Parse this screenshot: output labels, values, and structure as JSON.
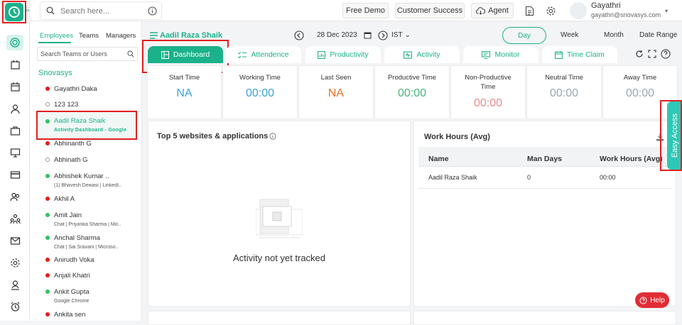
{
  "colors": {
    "accent": "#1bb18a",
    "highlight": "#e02020",
    "na_blue": "#3aa3d8",
    "na_orange": "#e07020",
    "time_green": "#49b77a",
    "time_red": "#e88a8a",
    "time_gray": "#9aa6b2",
    "easy_access": "#2ec8b6",
    "help": "#e12d35"
  },
  "topbar": {
    "search_placeholder": "Search here...",
    "free_demo": "Free Demo",
    "customer_success": "Customer Success",
    "agent": "Agent",
    "user_name": "Gayathri",
    "user_email": "gayathri@snovasys.com"
  },
  "rail": {
    "icons": [
      "target-icon",
      "inbox-icon",
      "calendar-icon",
      "user-icon",
      "briefcase-icon",
      "monitor-icon",
      "card-icon",
      "users-icon",
      "org-icon",
      "mail-icon",
      "settings-icon",
      "person-icon",
      "alarm-icon"
    ]
  },
  "sidebar": {
    "tabs": [
      "Employees",
      "Teams",
      "Managers"
    ],
    "search_placeholder": "Search Teams or Users",
    "org": "Snovasys",
    "employees": [
      {
        "name": "Gayathri Daka",
        "status": "red",
        "sub": ""
      },
      {
        "name": "123 123",
        "status": "off",
        "sub": ""
      },
      {
        "name": "Aadil Raza Shaik",
        "status": "green",
        "sub": "Activity Dashboard - Google"
      },
      {
        "name": "Abhinanth G",
        "status": "red",
        "sub": ""
      },
      {
        "name": "Abhinath G",
        "status": "off",
        "sub": ""
      },
      {
        "name": "Abhishek Kumar ..",
        "status": "green",
        "sub": "(1) Bhavesh Dewasi | LinkedI.."
      },
      {
        "name": "Akhil A",
        "status": "red",
        "sub": ""
      },
      {
        "name": "Amit Jain",
        "status": "green",
        "sub": "Chat | Priyanka Sharma | Mic.."
      },
      {
        "name": "Anchal Sharma",
        "status": "green",
        "sub": "Chat | Sai Sravani | Microso.."
      },
      {
        "name": "Anirudh Voka",
        "status": "red",
        "sub": ""
      },
      {
        "name": "Anjali Khatri",
        "status": "red",
        "sub": ""
      },
      {
        "name": "Ankit Gupta",
        "status": "green",
        "sub": "Google Chrome"
      },
      {
        "name": "Ankita sen",
        "status": "red",
        "sub": ""
      }
    ]
  },
  "header": {
    "employee": "Aadil Raza Shaik",
    "date": "28 Dec 2023",
    "timezone": "IST",
    "ranges": [
      "Day",
      "Week",
      "Month",
      "Date Range"
    ]
  },
  "tabs": [
    {
      "label": "Dashboard",
      "icon": "dashboard-icon"
    },
    {
      "label": "Attendence",
      "icon": "checklist-icon"
    },
    {
      "label": "Productivity",
      "icon": "chart-icon"
    },
    {
      "label": "Activity",
      "icon": "activity-icon"
    },
    {
      "label": "Monitor",
      "icon": "monitor-icon"
    },
    {
      "label": "Time Claim",
      "icon": "calendar-icon"
    }
  ],
  "stats": [
    {
      "label": "Start Time",
      "value": "NA"
    },
    {
      "label": "Working Time",
      "value": "00:00"
    },
    {
      "label": "Last Seen",
      "value": "NA"
    },
    {
      "label": "Productive Time",
      "value": "00:00"
    },
    {
      "label": "Non-Productive Time",
      "value": "00:00"
    },
    {
      "label": "Neutral Time",
      "value": "00:00"
    },
    {
      "label": "Away Time",
      "value": "00:00"
    }
  ],
  "top5": {
    "title": "Top 5 websites & applications",
    "empty": "Activity not yet tracked"
  },
  "work_hours": {
    "title": "Work Hours (Avg)",
    "columns": [
      "Name",
      "Man Days",
      "Work Hours (Avg)"
    ],
    "rows": [
      {
        "name": "Aadil Raza Shaik",
        "man_days": "0",
        "work_hours": "00:00"
      }
    ]
  },
  "easy_access": "Easy Access",
  "help": "Help"
}
